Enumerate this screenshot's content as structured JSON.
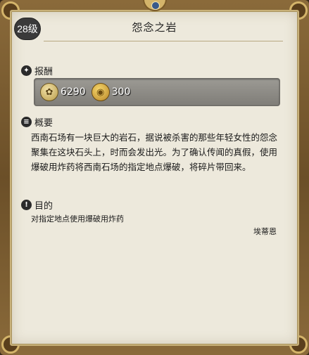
{
  "quest": {
    "level": "28级",
    "title": "怨念之岩"
  },
  "rewards": {
    "header": "报酬",
    "exp_icon": "exp-crystal-icon",
    "exp_value": "6290",
    "gil_icon": "gil-coin-icon",
    "gil_value": "300"
  },
  "summary": {
    "header": "概要",
    "text": "西南石场有一块巨大的岩石，据说被杀害的那些年轻女性的怨念聚集在这块石头上，时而会发出光。为了确认传闻的真假，使用爆破用炸药将西南石场的指定地点爆破，将碎片带回来。"
  },
  "objective": {
    "header": "目的",
    "text": "对指定地点使用爆破用炸药"
  },
  "npc": {
    "name": "埃蒂恩"
  },
  "colors": {
    "panel_bg": "#ede9dc",
    "frame": "#8a6a3a",
    "reward_bar": "#8c8a85"
  }
}
